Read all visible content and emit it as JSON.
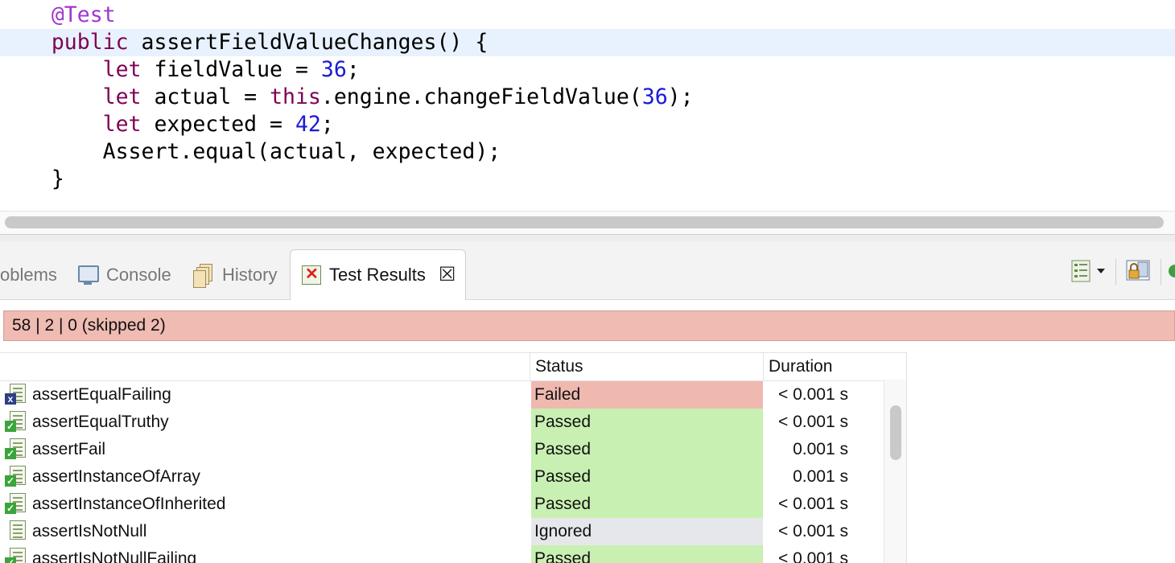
{
  "colors": {
    "failed_bg": "#efb9b0",
    "passed_bg": "#c8f0b2",
    "ignored_bg": "#e6e7ea",
    "summary_bg": "#efbbb2",
    "current_line_bg": "#e8f2fe"
  },
  "editor": {
    "lines": [
      {
        "annotation": "@Test"
      },
      {
        "keyword": "public",
        "rest": " assertFieldValueChanges() {"
      },
      {
        "keyword": "let",
        "before": " fieldValue = ",
        "number": "36",
        "after": ";"
      },
      {
        "keyword": "let",
        "before": " actual = ",
        "keyword2": "this",
        "middle": ".engine.changeFieldValue(",
        "number": "36",
        "after": ");"
      },
      {
        "keyword": "let",
        "before": " expected = ",
        "number": "42",
        "after": ";"
      },
      {
        "text": "Assert.equal(actual, expected);"
      },
      {
        "text": "}"
      }
    ]
  },
  "tabs": {
    "problems": "oblems",
    "console": "Console",
    "history": "History",
    "test_results": "Test Results",
    "close_icon": "close-icon"
  },
  "toolbar": {
    "icons": [
      "layout-menu-icon",
      "dropdown-arrow-icon",
      "lock-icon",
      "run-icon"
    ]
  },
  "summary": {
    "text": "58 | 2 | 0  (skipped 2)"
  },
  "table": {
    "columns": {
      "name": "",
      "status": "Status",
      "duration": "Duration"
    },
    "rows": [
      {
        "name": "assertEqualFailing",
        "status": "Failed",
        "duration": "< 0.001 s",
        "icon": "test-failed-icon"
      },
      {
        "name": "assertEqualTruthy",
        "status": "Passed",
        "duration": "< 0.001 s",
        "icon": "test-passed-icon"
      },
      {
        "name": "assertFail",
        "status": "Passed",
        "duration": "0.001 s",
        "icon": "test-passed-icon"
      },
      {
        "name": "assertInstanceOfArray",
        "status": "Passed",
        "duration": "0.001 s",
        "icon": "test-passed-icon"
      },
      {
        "name": "assertInstanceOfInherited",
        "status": "Passed",
        "duration": "< 0.001 s",
        "icon": "test-passed-icon"
      },
      {
        "name": "assertIsNotNull",
        "status": "Ignored",
        "duration": "< 0.001 s",
        "icon": "test-ignored-icon"
      },
      {
        "name": "assertIsNotNullFailing",
        "status": "Passed",
        "duration": "< 0.001 s",
        "icon": "test-passed-icon"
      }
    ]
  }
}
